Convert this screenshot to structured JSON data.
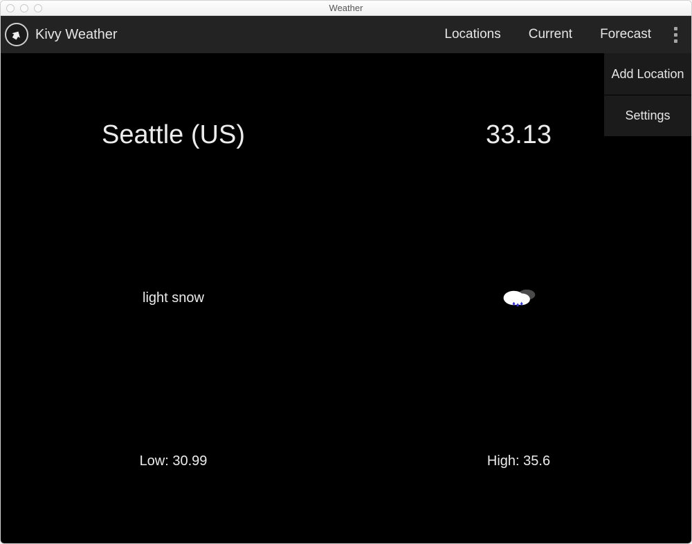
{
  "window": {
    "title": "Weather"
  },
  "app": {
    "title": "Kivy Weather"
  },
  "nav": {
    "locations": "Locations",
    "current": "Current",
    "forecast": "Forecast"
  },
  "menu": {
    "add_location": "Add Location",
    "settings": "Settings"
  },
  "weather": {
    "location": "Seattle (US)",
    "temperature": "33.13",
    "conditions": "light snow",
    "low": "Low: 30.99",
    "high": "High: 35.6"
  }
}
